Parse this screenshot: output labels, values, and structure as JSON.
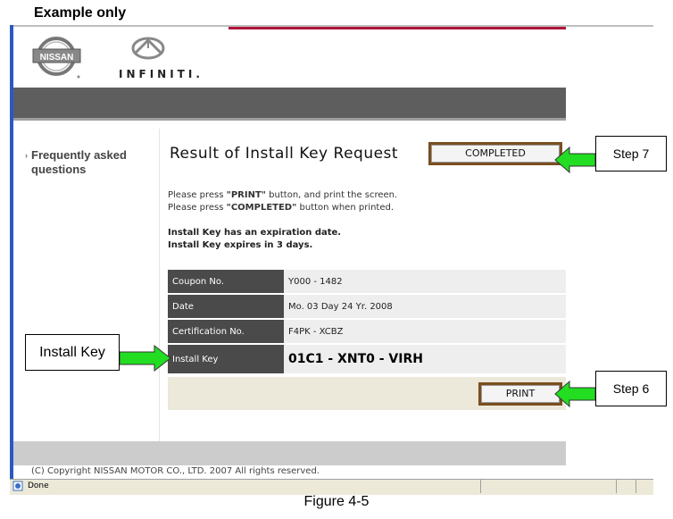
{
  "annotation": {
    "example_label": "Example only",
    "figure_caption": "Figure 4-5",
    "step7_label": "Step 7",
    "step6_label": "Step 6",
    "install_key_label": "Install Key",
    "arrow_color": "#22dd22"
  },
  "brand": {
    "nissan_logo_text": "NISSAN",
    "infiniti_text": "INFINITI."
  },
  "sidebar": {
    "faq_label": "Frequently asked questions"
  },
  "main": {
    "title": "Result of Install Key Request",
    "completed_button": "COMPLETED",
    "instructions": {
      "line1_prefix": "Please press ",
      "line1_bold": "\"PRINT\"",
      "line1_suffix": " button, and print the screen.",
      "line2_prefix": "Please press ",
      "line2_bold": "\"COMPLETED\"",
      "line2_suffix": " button when printed."
    },
    "expiration": {
      "line1": "Install Key has an expiration date.",
      "line2": "Install Key expires in 3 days."
    },
    "table": [
      {
        "label": "Coupon No.",
        "value": "Y000 - 1482"
      },
      {
        "label": "Date",
        "value": "Mo. 03 Day 24 Yr. 2008"
      },
      {
        "label": "Certification No.",
        "value": "F4PK - XCBZ"
      },
      {
        "label": "Install Key",
        "value": "01C1 - XNT0 - VIRH"
      }
    ],
    "print_button": "PRINT"
  },
  "footer": {
    "copyright": "(C) Copyright NISSAN MOTOR CO., LTD. 2007 All rights reserved."
  },
  "statusbar": {
    "status_text": "Done"
  },
  "colors": {
    "header_band": "#5e5e5e",
    "accent_red": "#b0163a",
    "button_border": "#7a4f1f",
    "table_label_bg": "#4a4a4a",
    "ie_blue": "#2b59c3"
  }
}
